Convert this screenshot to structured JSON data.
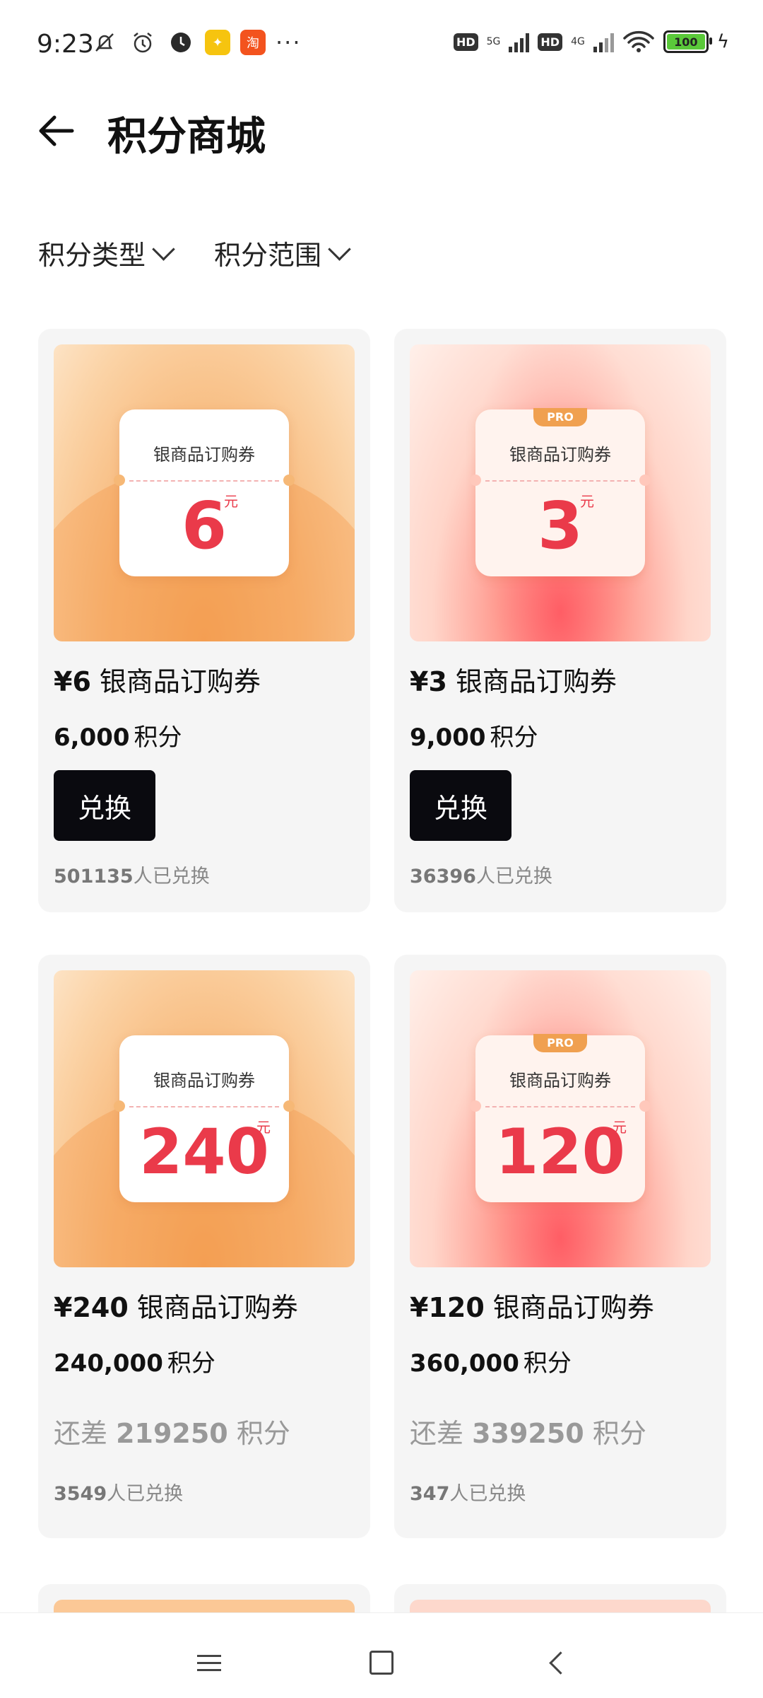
{
  "status_bar": {
    "time": "9:23",
    "icons": [
      "mute-bell-icon",
      "alarm-icon",
      "clock-app-icon",
      "app-icon-yellow",
      "taobao-app-icon",
      "more-icon"
    ],
    "more": "···",
    "hd1": "HD",
    "net1": "5G",
    "hd2": "HD",
    "net2": "4G",
    "battery": "100"
  },
  "header": {
    "title": "积分商城"
  },
  "filters": [
    {
      "label": "积分类型"
    },
    {
      "label": "积分范围"
    }
  ],
  "products": [
    {
      "coupon_title": "银商品订购券",
      "coupon_value": "6",
      "coupon_unit": "元",
      "pro": false,
      "theme": "orange",
      "price": "¥6",
      "name": "银商品订购券",
      "points": "6,000",
      "points_unit": "积分",
      "button": "兑换",
      "count": "501135",
      "count_suffix": "人已兑换"
    },
    {
      "coupon_title": "银商品订购券",
      "coupon_value": "3",
      "coupon_unit": "元",
      "pro": true,
      "pro_label": "PRO",
      "theme": "pink",
      "price": "¥3",
      "name": "银商品订购券",
      "points": "9,000",
      "points_unit": "积分",
      "button": "兑换",
      "count": "36396",
      "count_suffix": "人已兑换"
    },
    {
      "coupon_title": "银商品订购券",
      "coupon_value": "240",
      "coupon_unit": "元",
      "pro": false,
      "theme": "orange",
      "price": "¥240",
      "name": "银商品订购券",
      "points": "240,000",
      "points_unit": "积分",
      "short_prefix": "还差",
      "short_value": "219250",
      "short_suffix": "积分",
      "count": "3549",
      "count_suffix": "人已兑换"
    },
    {
      "coupon_title": "银商品订购券",
      "coupon_value": "120",
      "coupon_unit": "元",
      "pro": true,
      "pro_label": "PRO",
      "theme": "pink",
      "price": "¥120",
      "name": "银商品订购券",
      "points": "360,000",
      "points_unit": "积分",
      "short_prefix": "还差",
      "short_value": "339250",
      "short_suffix": "积分",
      "count": "347",
      "count_suffix": "人已兑换"
    }
  ],
  "nav": [
    "menu-icon",
    "home-icon",
    "back-icon"
  ]
}
